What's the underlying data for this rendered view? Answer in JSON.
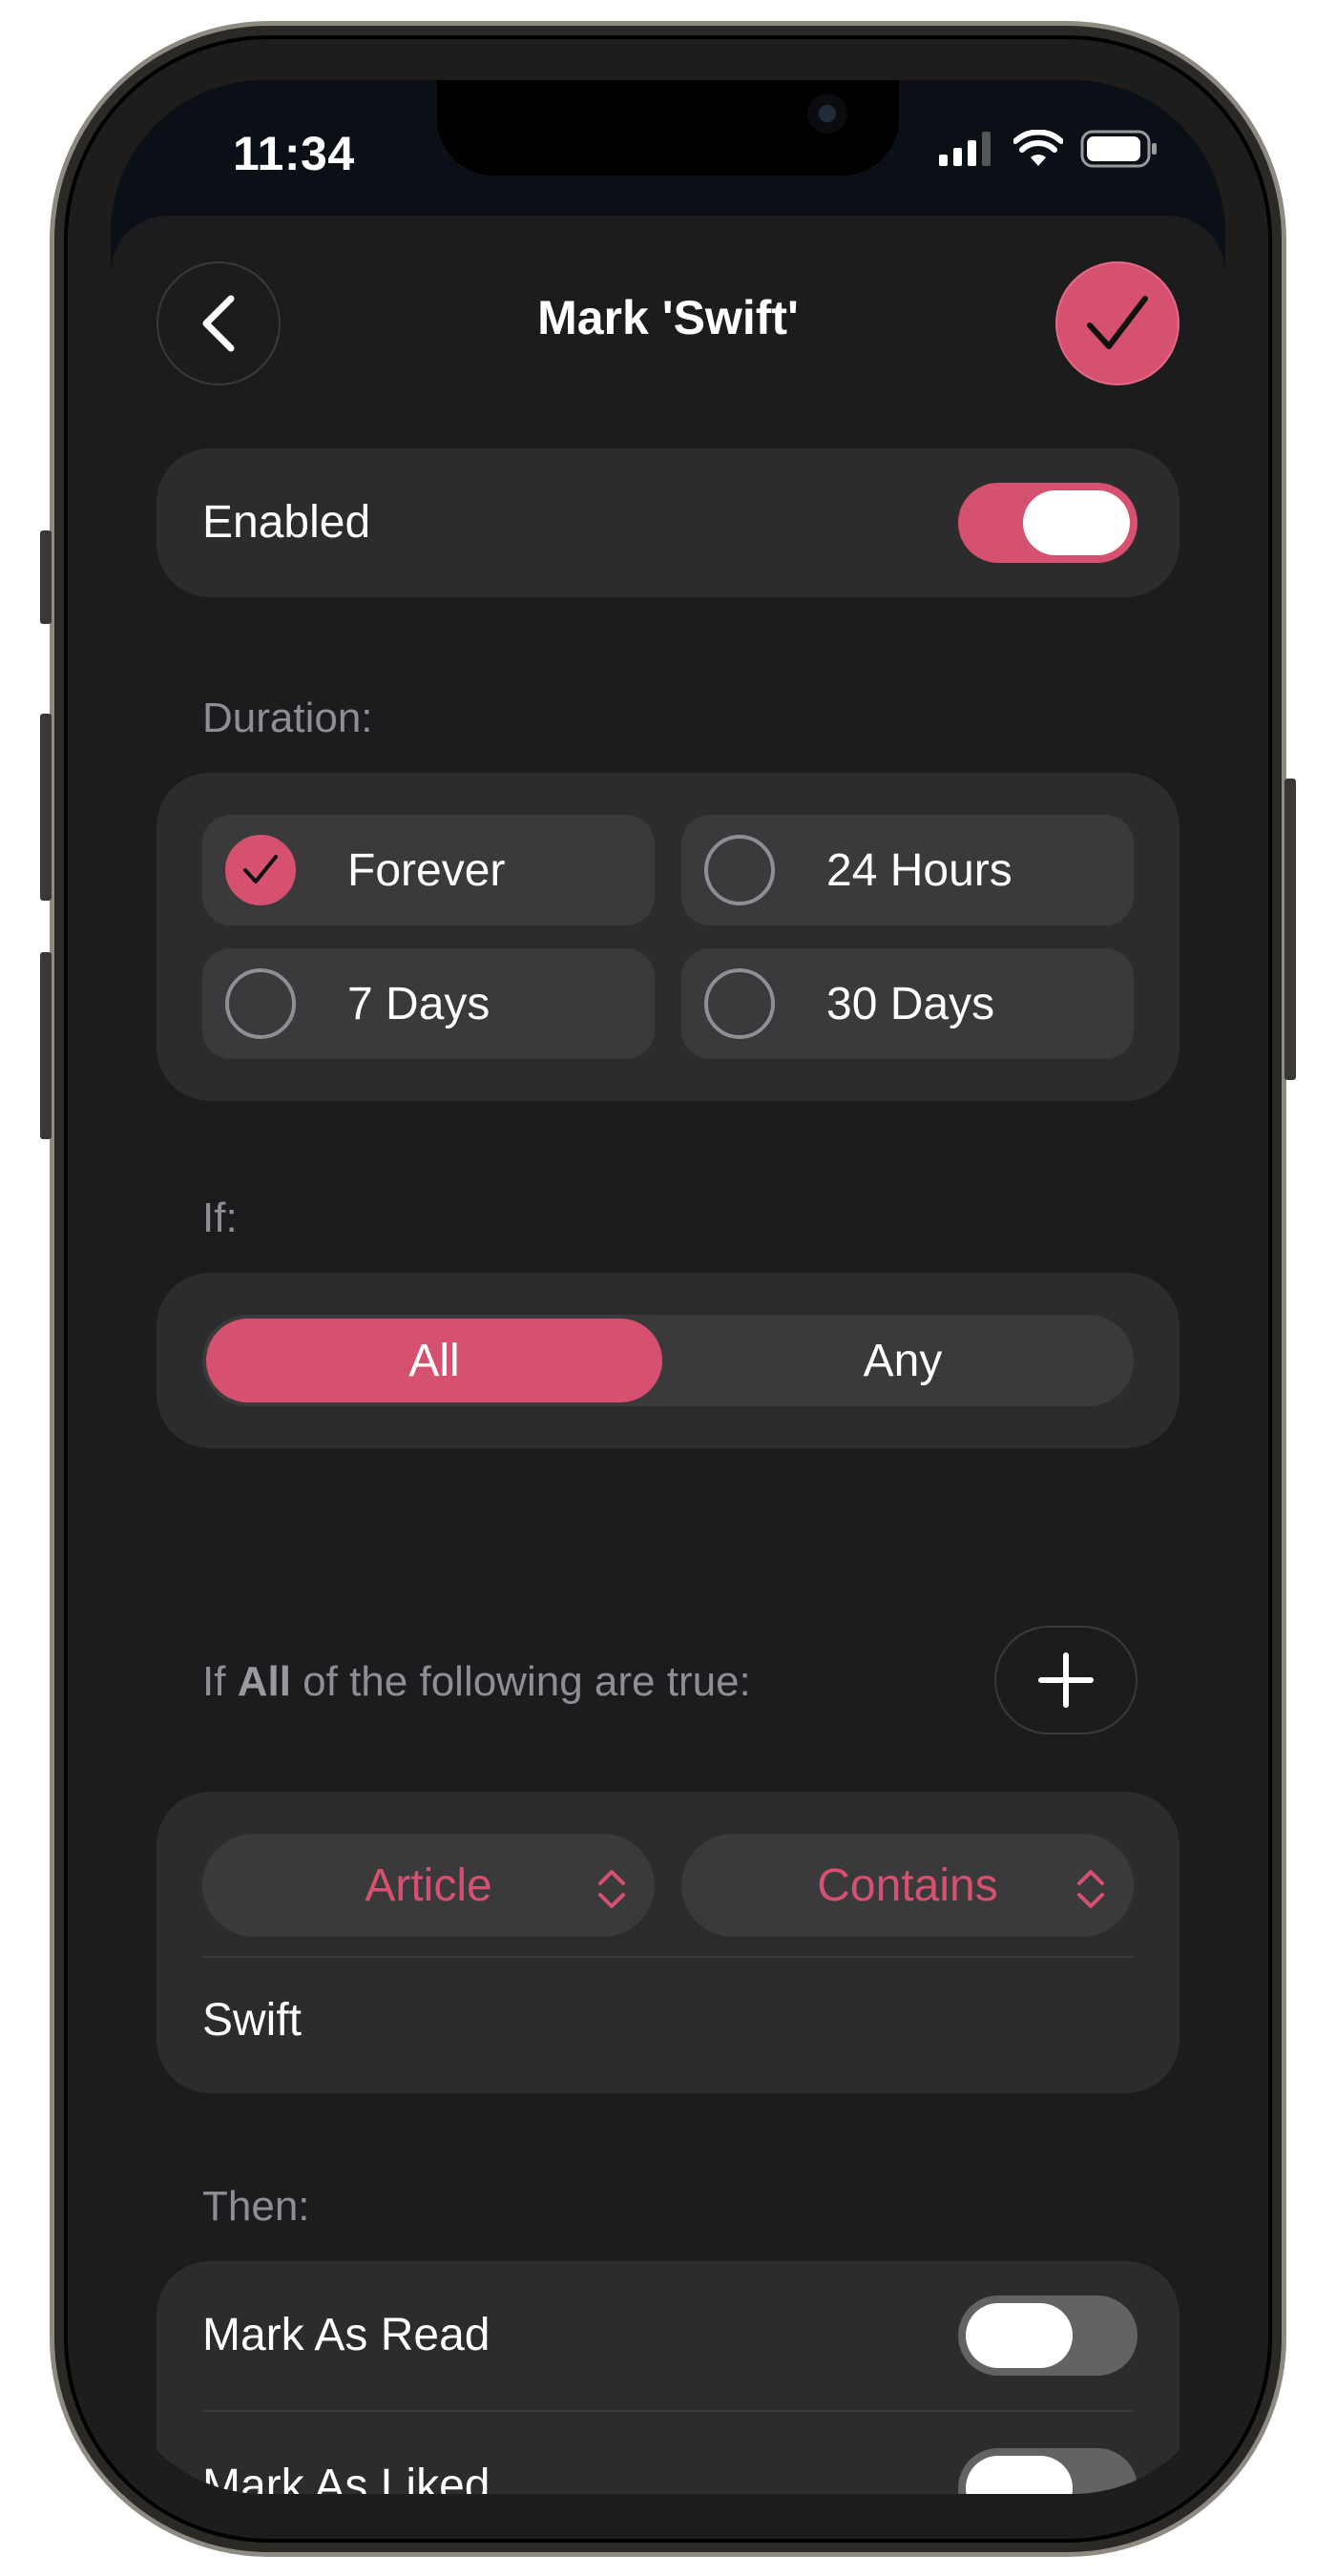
{
  "status_bar": {
    "time": "11:34"
  },
  "header": {
    "title": "Mark 'Swift'"
  },
  "enabled": {
    "label": "Enabled",
    "on": true
  },
  "duration": {
    "label": "Duration:",
    "options": [
      {
        "label": "Forever",
        "checked": true
      },
      {
        "label": "24 Hours",
        "checked": false
      },
      {
        "label": "7 Days",
        "checked": false
      },
      {
        "label": "30 Days",
        "checked": false
      }
    ]
  },
  "condition": {
    "label": "If:",
    "segments": [
      "All",
      "Any"
    ],
    "selected": "All"
  },
  "rules": {
    "heading_prefix": "If",
    "heading_strong": "All",
    "heading_suffix": "of the following are true:",
    "field_picker": "Article",
    "operator_picker": "Contains",
    "value": "Swift"
  },
  "actions": {
    "label": "Then:",
    "items": [
      {
        "label": "Mark As Read",
        "on": false
      },
      {
        "label": "Mark As Liked",
        "on": false
      }
    ]
  },
  "colors": {
    "accent": "#d6506f",
    "background": "#1c1c1e",
    "card": "#2c2c2e"
  }
}
